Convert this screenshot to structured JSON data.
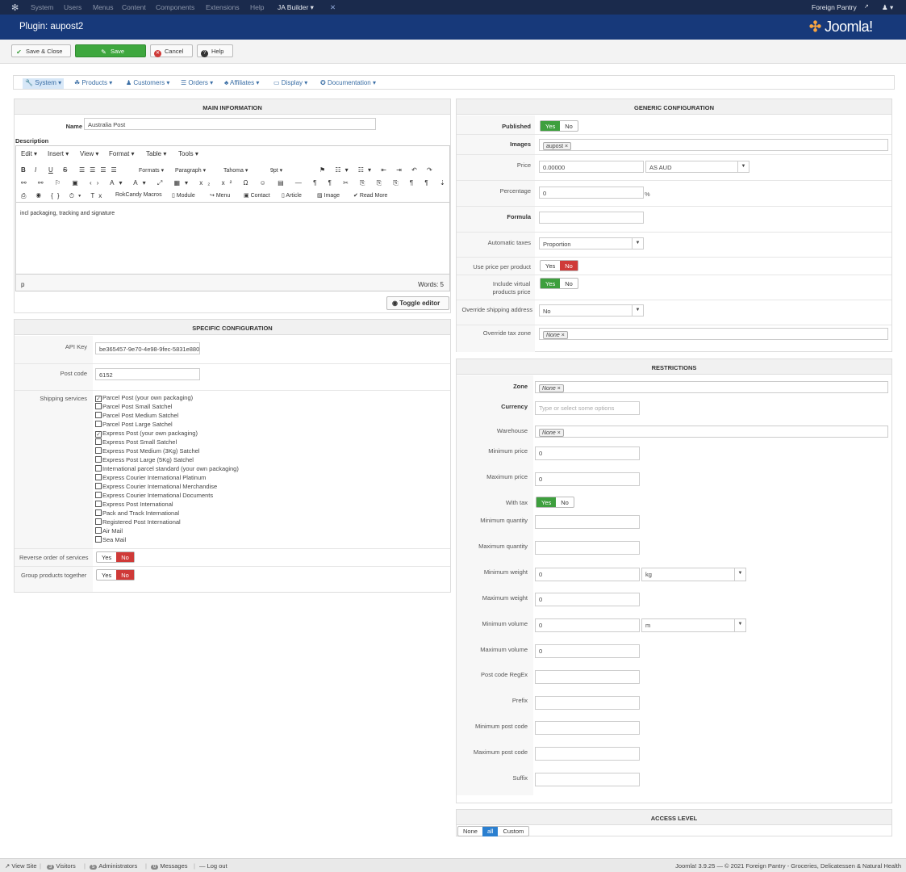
{
  "topnav": {
    "items": [
      "System",
      "Users",
      "Menus",
      "Content",
      "Components",
      "Extensions",
      "Help",
      "JA Builder ▾"
    ],
    "site_name": "Foreign Pantry",
    "user_icon": "user-icon"
  },
  "title": {
    "text": "Plugin: aupost2",
    "logo_text": "Joomla!"
  },
  "toolbar": {
    "save_close": "Save & Close",
    "save": "Save",
    "cancel": "Cancel",
    "help": "Help"
  },
  "submenu": [
    "System",
    "Products",
    "Customers",
    "Orders",
    "Affiliates",
    "Display",
    "Documentation"
  ],
  "main_info": {
    "header": "MAIN INFORMATION",
    "name_label": "Name",
    "name_value": "Australia Post",
    "description_label": "Description",
    "editor_menu": [
      "Edit ▾",
      "Insert ▾",
      "View ▾",
      "Format ▾",
      "Table ▾",
      "Tools ▾"
    ],
    "toolbar_row1": [
      "B",
      "I",
      "U",
      "S",
      "Formats ▾",
      "Paragraph ▾",
      "Tahoma ▾",
      "9pt ▾"
    ],
    "toolbar_row3": [
      "RokCandy Macros",
      "Module",
      "Menu",
      "Contact",
      "Article",
      "Image",
      "Read More"
    ],
    "content": "incl packaging, tracking and signature",
    "status_path": "p",
    "words": "Words: 5",
    "toggle_editor": "Toggle editor"
  },
  "specific": {
    "header": "SPECIFIC CONFIGURATION",
    "api_key_label": "API Key",
    "api_key_value": "be365457-9e70-4e98-9fec-5831e880",
    "postcode_label": "Post code",
    "postcode_value": "6152",
    "shipping_label": "Shipping services",
    "services": [
      {
        "label": "Parcel Post (your own packaging)",
        "checked": true
      },
      {
        "label": "Parcel Post Small Satchel",
        "checked": false
      },
      {
        "label": "Parcel Post Medium Satchel",
        "checked": false
      },
      {
        "label": "Parcel Post Large Satchel",
        "checked": false
      },
      {
        "label": "Express Post (your own packaging)",
        "checked": true
      },
      {
        "label": "Express Post Small Satchel",
        "checked": false
      },
      {
        "label": "Express Post Medium (3Kg) Satchel",
        "checked": false
      },
      {
        "label": "Express Post Large (5Kg) Satchel",
        "checked": false
      },
      {
        "label": "International parcel standard (your own packaging)",
        "checked": false
      },
      {
        "label": "Express Courier International Platinum",
        "checked": false
      },
      {
        "label": "Express Courier International Merchandise",
        "checked": false
      },
      {
        "label": "Express Courier International Documents",
        "checked": false
      },
      {
        "label": "Express Post International",
        "checked": false
      },
      {
        "label": "Pack and Track International",
        "checked": false
      },
      {
        "label": "Registered Post International",
        "checked": false
      },
      {
        "label": "Air Mail",
        "checked": false
      },
      {
        "label": "Sea Mail",
        "checked": false
      }
    ],
    "reverse_label": "Reverse order of services",
    "group_label": "Group products together",
    "yes": "Yes",
    "no": "No"
  },
  "generic": {
    "header": "GENERIC CONFIGURATION",
    "published_label": "Published",
    "images_label": "Images",
    "images_value": "aupost",
    "price_label": "Price",
    "price_value": "0.00000",
    "currency_value": "AS AUD",
    "percentage_label": "Percentage",
    "percentage_value": "0",
    "percent_sign": "%",
    "formula_label": "Formula",
    "auto_taxes_label": "Automatic taxes",
    "auto_taxes_value": "Proportion",
    "use_price_label": "Use price per product",
    "include_virtual_label_1": "Include virtual",
    "include_virtual_label_2": "products price",
    "override_shipping_label": "Override shipping address",
    "override_shipping_value": "No",
    "override_tax_label": "Override tax zone",
    "override_tax_value": "None",
    "yes": "Yes",
    "no": "No"
  },
  "restrictions": {
    "header": "RESTRICTIONS",
    "zone_label": "Zone",
    "zone_value": "None",
    "currency_label": "Currency",
    "currency_placeholder": "Type or select some options",
    "warehouse_label": "Warehouse",
    "warehouse_value": "None",
    "min_price_label": "Minimum price",
    "min_price_value": "0",
    "max_price_label": "Maximum price",
    "max_price_value": "0",
    "with_tax_label": "With tax",
    "min_qty_label": "Minimum quantity",
    "max_qty_label": "Maximum quantity",
    "min_weight_label": "Minimum weight",
    "min_weight_value": "0",
    "weight_unit": "kg",
    "max_weight_label": "Maximum weight",
    "max_weight_value": "0",
    "min_volume_label": "Minimum volume",
    "min_volume_value": "0",
    "volume_unit": "m",
    "max_volume_label": "Maximum volume",
    "max_volume_value": "0",
    "postcode_regex_label": "Post code RegEx",
    "prefix_label": "Prefix",
    "min_postcode_label": "Minimum post code",
    "max_postcode_label": "Maximum post code",
    "suffix_label": "Suffix",
    "yes": "Yes",
    "no": "No"
  },
  "access": {
    "header": "ACCESS LEVEL",
    "none": "None",
    "all": "all",
    "custom": "Custom"
  },
  "footer": {
    "view_site": "View Site",
    "visitors_count": "3",
    "visitors": "Visitors",
    "admins_count": "5",
    "admins": "Administrators",
    "messages_count": "0",
    "messages": "Messages",
    "logout": "Log out",
    "copyright": "Joomla! 3.9.25 — © 2021 Foreign Pantry - Groceries, Delicatessen & Natural Health"
  }
}
